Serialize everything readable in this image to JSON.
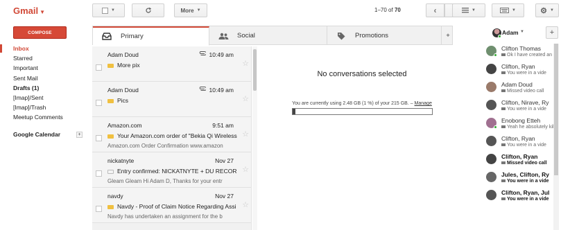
{
  "app": {
    "logo": "Gmail"
  },
  "toolbar": {
    "more_label": "More",
    "count_range": "1–70",
    "count_of": "of",
    "count_total": "70"
  },
  "nav": {
    "compose_label": "COMPOSE",
    "items": [
      {
        "label": "Inbox"
      },
      {
        "label": "Starred"
      },
      {
        "label": "Important"
      },
      {
        "label": "Sent Mail"
      },
      {
        "label": "Drafts (1)"
      },
      {
        "label": "[Imap]/Sent"
      },
      {
        "label": "[Imap]/Trash"
      },
      {
        "label": "Meetup Comments"
      }
    ],
    "calendar_label": "Google Calendar"
  },
  "tabs": [
    {
      "label": "Primary"
    },
    {
      "label": "Social"
    },
    {
      "label": "Promotions"
    }
  ],
  "messages": [
    {
      "sender": "Adam Doud",
      "time": "10:49 am",
      "subject": "More pix",
      "snippet": ""
    },
    {
      "sender": "Adam Doud",
      "time": "10:49 am",
      "subject": "Pics",
      "snippet": ""
    },
    {
      "sender": "Amazon.com",
      "time": "9:51 am",
      "subject": "Your Amazon.com order of \"Bekia Qi Wireless",
      "snippet": "Amazon.com Order Confirmation www.amazon"
    },
    {
      "sender": "nickatnyte",
      "time": "Nov 27",
      "subject": "Entry confirmed: NICKATNYTE + DU RECOR",
      "snippet": "Gleam Gleam Hi Adam D, Thanks for your entr"
    },
    {
      "sender": "navdy",
      "time": "Nov 27",
      "subject": "Navdy - Proof of Claim Notice Regarding Assi",
      "snippet": "Navdy has undertaken an assignment for the b"
    }
  ],
  "reading_pane": {
    "title": "No conversations selected",
    "storage_text": "You are currently using 2.48 GB (1 %) of your 215 GB. –",
    "manage_label": "Manage",
    "quota_fraction": 0.012
  },
  "chat": {
    "me_name": "Adam",
    "contacts": [
      {
        "name": "Clifton Thomas",
        "status": "Ok I have created an",
        "bold": false,
        "online": true,
        "avatar": "#6f8f6f"
      },
      {
        "name": "Clifton, Ryan",
        "status": "You were in a vide",
        "bold": false,
        "online": false,
        "avatar": "#444"
      },
      {
        "name": "Adam Doud",
        "status": "Missed video call",
        "bold": false,
        "online": false,
        "avatar": "#9a7a6a"
      },
      {
        "name": "Clifton, Nirave, Ry",
        "status": "You were in a vide",
        "bold": false,
        "online": false,
        "avatar": "#555"
      },
      {
        "name": "Enobong Etteh",
        "status": "Yeah he absolutely kil",
        "bold": false,
        "online": true,
        "avatar": "#a07090"
      },
      {
        "name": "Clifton, Ryan",
        "status": "You were in a vide",
        "bold": false,
        "online": false,
        "avatar": "#555"
      },
      {
        "name": "Clifton, Ryan",
        "status": "Missed video call",
        "bold": true,
        "online": false,
        "avatar": "#444"
      },
      {
        "name": "Jules, Clifton, Ry",
        "status": "You were in a vide",
        "bold": true,
        "online": false,
        "avatar": "#666"
      },
      {
        "name": "Clifton, Ryan, Jul",
        "status": "You were in a vide",
        "bold": true,
        "online": false,
        "avatar": "#555"
      }
    ]
  },
  "colors": {
    "brand_red": "#d14836",
    "compose_red": "#d64937",
    "label_yellow": "#f0c040"
  }
}
